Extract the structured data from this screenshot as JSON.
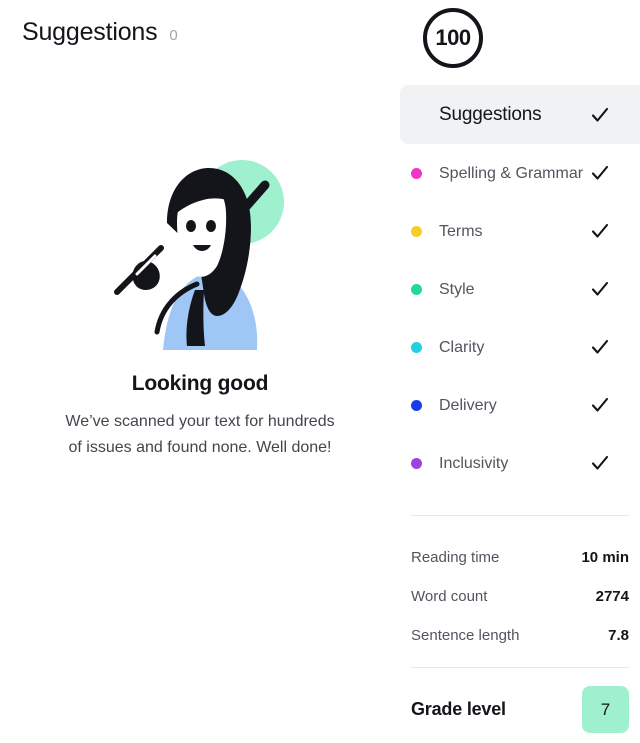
{
  "main": {
    "title": "Suggestions",
    "count": "0",
    "empty_state": {
      "title": "Looking good",
      "body": "We’ve scanned your text for hundreds of issues and found none. Well done!",
      "illustration_name": "person-writing-with-check-illustration",
      "check_circle_color": "#9EF0CE",
      "shirt_color": "#9EC7F5",
      "ink_color": "#14141B"
    }
  },
  "sidebar": {
    "score": {
      "value": "100",
      "ring_color": "#14141B"
    },
    "header": {
      "label": "Suggestions",
      "checked": true,
      "background": "#F1F2F4"
    },
    "categories": [
      {
        "label": "Spelling & Grammar",
        "color": "#ED35C6",
        "checked": true
      },
      {
        "label": "Terms",
        "color": "#F6CE2C",
        "checked": true
      },
      {
        "label": "Style",
        "color": "#23D5A0",
        "checked": true
      },
      {
        "label": "Clarity",
        "color": "#26CFE0",
        "checked": true
      },
      {
        "label": "Delivery",
        "color": "#1A3CE8",
        "checked": true
      },
      {
        "label": "Inclusivity",
        "color": "#9B45E0",
        "checked": true
      }
    ],
    "stats": [
      {
        "label": "Reading time",
        "value": "10 min"
      },
      {
        "label": "Word count",
        "value": "2774"
      },
      {
        "label": "Sentence length",
        "value": "7.8"
      }
    ],
    "grade": {
      "label": "Grade level",
      "value": "7",
      "badge_color": "#9EF0CE"
    }
  }
}
